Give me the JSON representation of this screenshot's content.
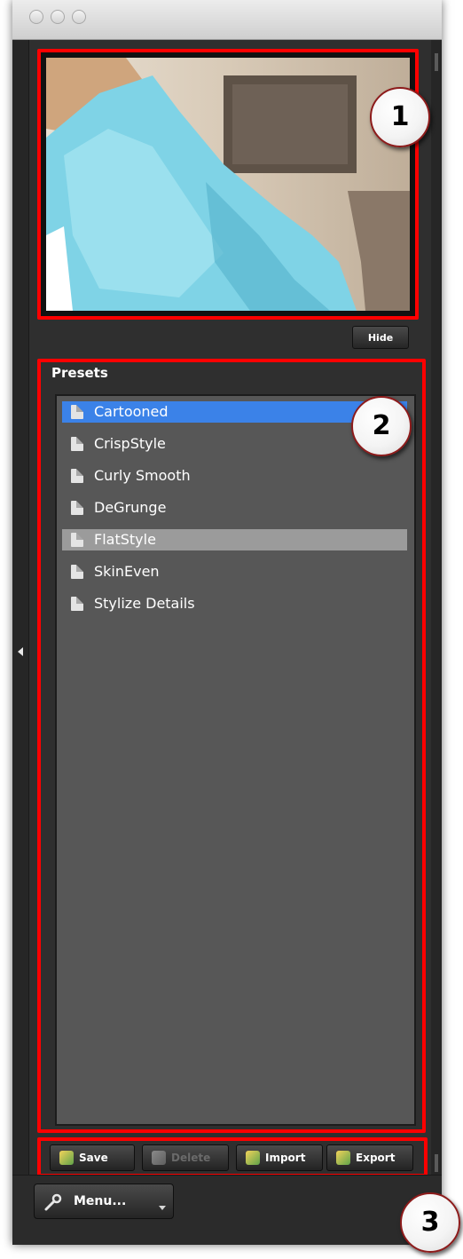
{
  "callouts": [
    "1",
    "2",
    "3"
  ],
  "preview": {
    "hide_label": "Hide"
  },
  "presets": {
    "title": "Presets",
    "items": [
      {
        "label": "Cartooned",
        "state": "selected"
      },
      {
        "label": "CrispStyle",
        "state": "normal"
      },
      {
        "label": "Curly Smooth",
        "state": "normal"
      },
      {
        "label": "DeGrunge",
        "state": "normal"
      },
      {
        "label": "FlatStyle",
        "state": "hover"
      },
      {
        "label": "SkinEven",
        "state": "normal"
      },
      {
        "label": "Stylize Details",
        "state": "normal"
      }
    ]
  },
  "toolbar": {
    "save_label": "Save",
    "delete_label": "Delete",
    "import_label": "Import",
    "export_label": "Export"
  },
  "menu": {
    "label": "Menu..."
  },
  "colors": {
    "highlight_red": "#ff0000",
    "selection_blue": "#3b82e8",
    "list_background": "#575757",
    "panel_background": "#2f2f2f"
  }
}
